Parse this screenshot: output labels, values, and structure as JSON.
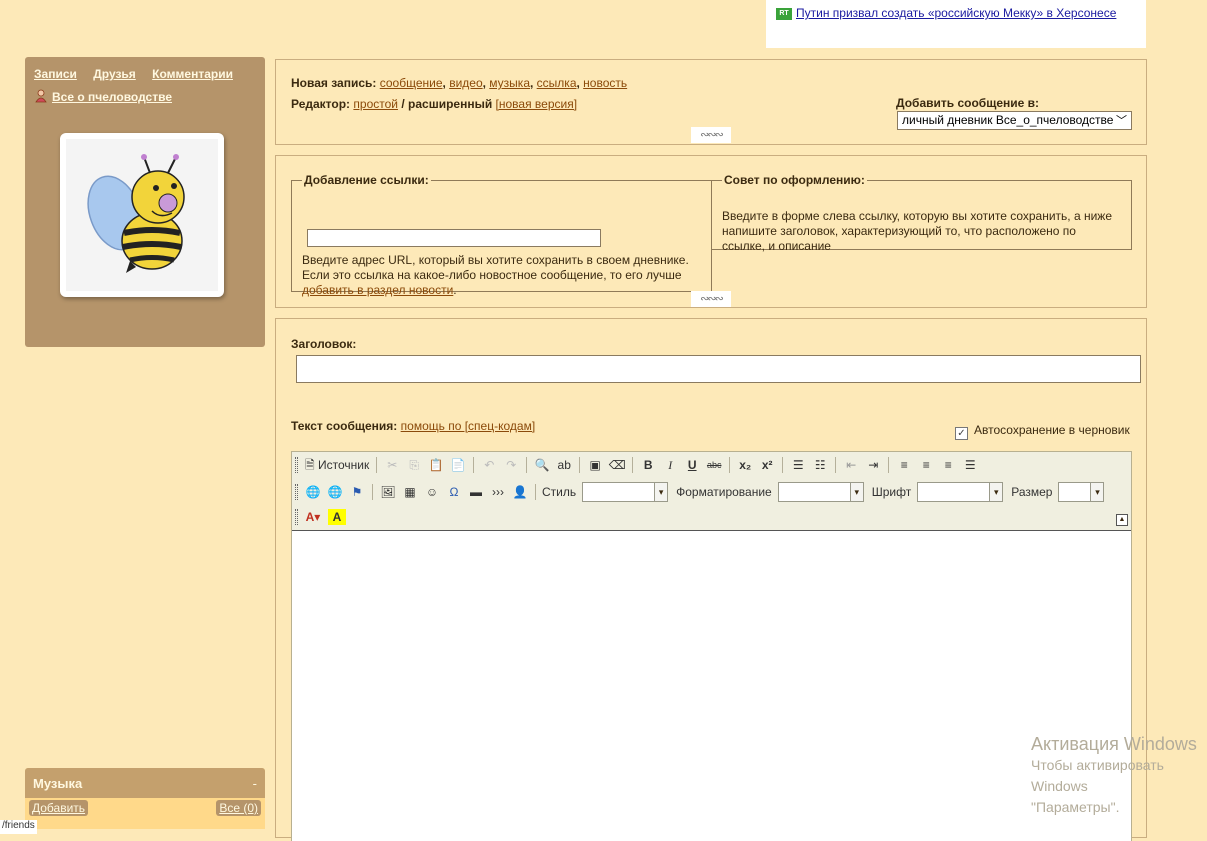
{
  "news": {
    "badge": "RT",
    "headline": "Путин призвал создать «российскую Мекку» в Херсонесе"
  },
  "sidebar": {
    "nav": [
      "Записи",
      "Друзья",
      "Комментарии"
    ],
    "user": "Все о пчеловодстве",
    "music": {
      "title": "Музыка",
      "minimize": "-",
      "add": "Добавить",
      "all": "Все (0)"
    },
    "friends_stub": "/friends"
  },
  "new_post": {
    "label": "Новая запись:",
    "types": [
      "сообщение",
      "видео",
      "музыка",
      "ссылка",
      "новость"
    ],
    "editor_label": "Редактор:",
    "editor_simple": "простой",
    "editor_advanced": "расширенный",
    "editor_new": "[новая версия]",
    "target_label": "Добавить сообщение в:",
    "target_value": "личный дневник Все_о_пчеловодстве"
  },
  "link_section": {
    "legend": "Добавление ссылки:",
    "url_value": "",
    "help_text": "Введите адрес URL, который вы хотите сохранить в своем дневнике. Если это ссылка на какое-либо новостное сообщение, то его лучше ",
    "help_link": "добавить в раздел новости",
    "help_end": ".",
    "tip_legend": "Совет по оформлению:",
    "tip_text": "Введите в форме слева ссылку, которую вы хотите сохранить, а ниже напишите заголовок, характеризующий то, что расположено по ссылке, и описание"
  },
  "post_form": {
    "title_label": "Заголовок:",
    "title_value": "",
    "message_label": "Текст сообщения:",
    "message_help": "помощь по [спец-кодам]",
    "autosave_label": "Автосохранение в черновик",
    "autosave_checked": true
  },
  "editor": {
    "source_label": "Источник",
    "style_label": "Стиль",
    "format_label": "Форматирование",
    "font_label": "Шрифт",
    "size_label": "Размер"
  },
  "watermark": {
    "line1": "Активация Windows",
    "line2": "Чтобы активировать Windows",
    "line3": "\"Параметры\"."
  }
}
